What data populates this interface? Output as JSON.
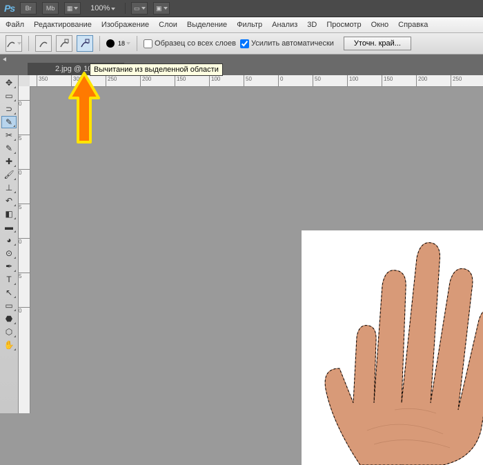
{
  "topbar": {
    "logo": "Ps",
    "btn_br": "Br",
    "btn_mb": "Mb",
    "zoom": "100%"
  },
  "menu": {
    "file": "Файл",
    "edit": "Редактирование",
    "image": "Изображение",
    "layer": "Слои",
    "select": "Выделение",
    "filter": "Фильтр",
    "analysis": "Анализ",
    "v3d": "3D",
    "view": "Просмотр",
    "window": "Окно",
    "help": "Справка"
  },
  "options": {
    "brush_size": "18",
    "sample_all": "Образец со всех слоев",
    "auto_enhance": "Усилить автоматически",
    "refine": "Уточн. край..."
  },
  "doc": {
    "tab": "2.jpg @ 100"
  },
  "tooltip": "Вычитание из выделенной области",
  "ruler_h": [
    "350",
    "300",
    "250",
    "200",
    "150",
    "100",
    "50",
    "0",
    "50",
    "100",
    "150",
    "200",
    "250"
  ],
  "ruler_v": [
    "0",
    "5",
    "0",
    "5",
    "0",
    "5",
    "0"
  ]
}
